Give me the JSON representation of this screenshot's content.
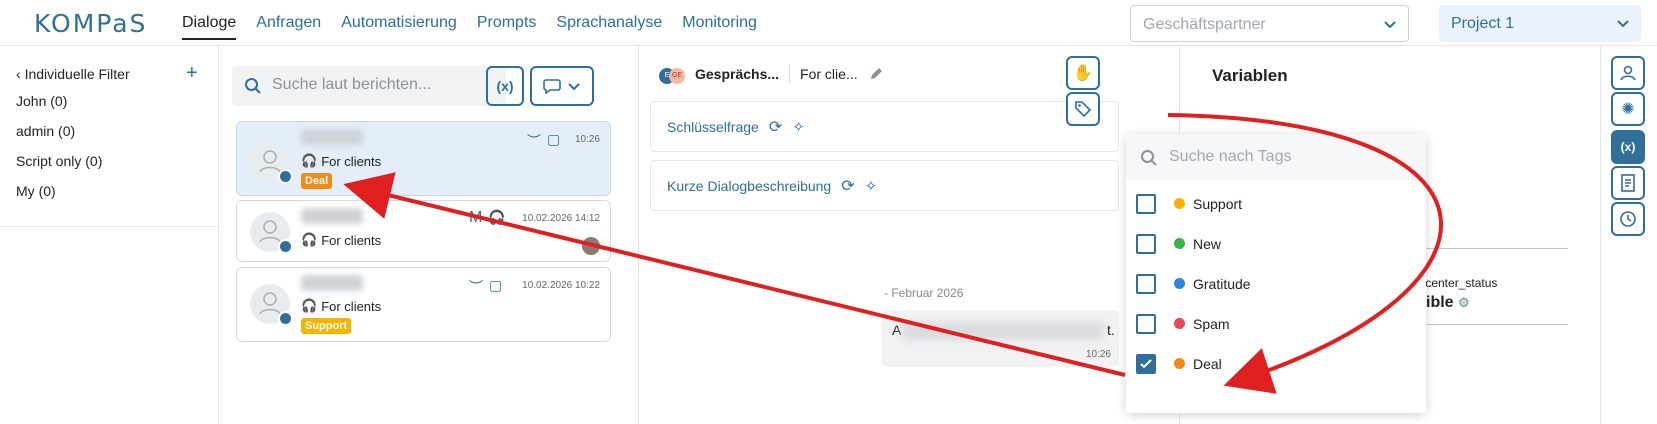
{
  "header": {
    "logo": "KOMPaS",
    "nav": [
      "Dialoge",
      "Anfragen",
      "Automatisierung",
      "Prompts",
      "Sprachanalyse",
      "Monitoring"
    ],
    "partner_placeholder": "Geschäftspartner",
    "project": "Project 1"
  },
  "filters": {
    "title": "Individuelle Filter",
    "items": [
      {
        "label": "John",
        "count": "(0)"
      },
      {
        "label": "admin",
        "count": "(0)"
      },
      {
        "label": "Script only",
        "count": "(0)"
      },
      {
        "label": "My",
        "count": "(0)"
      }
    ]
  },
  "search": {
    "placeholder": "Suche laut berichten..."
  },
  "dialogs": [
    {
      "client": "For clients",
      "time": "10:26",
      "tag": "Deal",
      "tag_color": "#f08a16"
    },
    {
      "client": "For clients",
      "time": "10.02.2026 14:12",
      "tag": "",
      "tag_color": ""
    },
    {
      "client": "For clients",
      "time": "10.02.2026 10:22",
      "tag": "Support",
      "tag_color": "#f5b400"
    }
  ],
  "conversation": {
    "title": "Gesprächs...",
    "subtitle": "For clie...",
    "boxes": [
      "Schlüsselfrage",
      "Kurze Dialogbeschreibung"
    ],
    "date": "Februar 2026",
    "msg_start": "A",
    "msg_end": "t.",
    "msg_time": "10:26"
  },
  "tags_dropdown": {
    "placeholder": "Suche nach Tags",
    "items": [
      {
        "label": "Support",
        "color": "#f5b400",
        "checked": false
      },
      {
        "label": "New",
        "color": "#3bb34a",
        "checked": false
      },
      {
        "label": "Gratitude",
        "color": "#2f86e0",
        "checked": false
      },
      {
        "label": "Spam",
        "color": "#e8485c",
        "checked": false
      },
      {
        "label": "Deal",
        "color": "#f08a16",
        "checked": true
      }
    ]
  },
  "variables": {
    "title": "Variablen",
    "key": "tcenter_status",
    "value": "ible"
  },
  "colors": {
    "accent": "#2f6f9a",
    "arrow": "#e02020"
  }
}
